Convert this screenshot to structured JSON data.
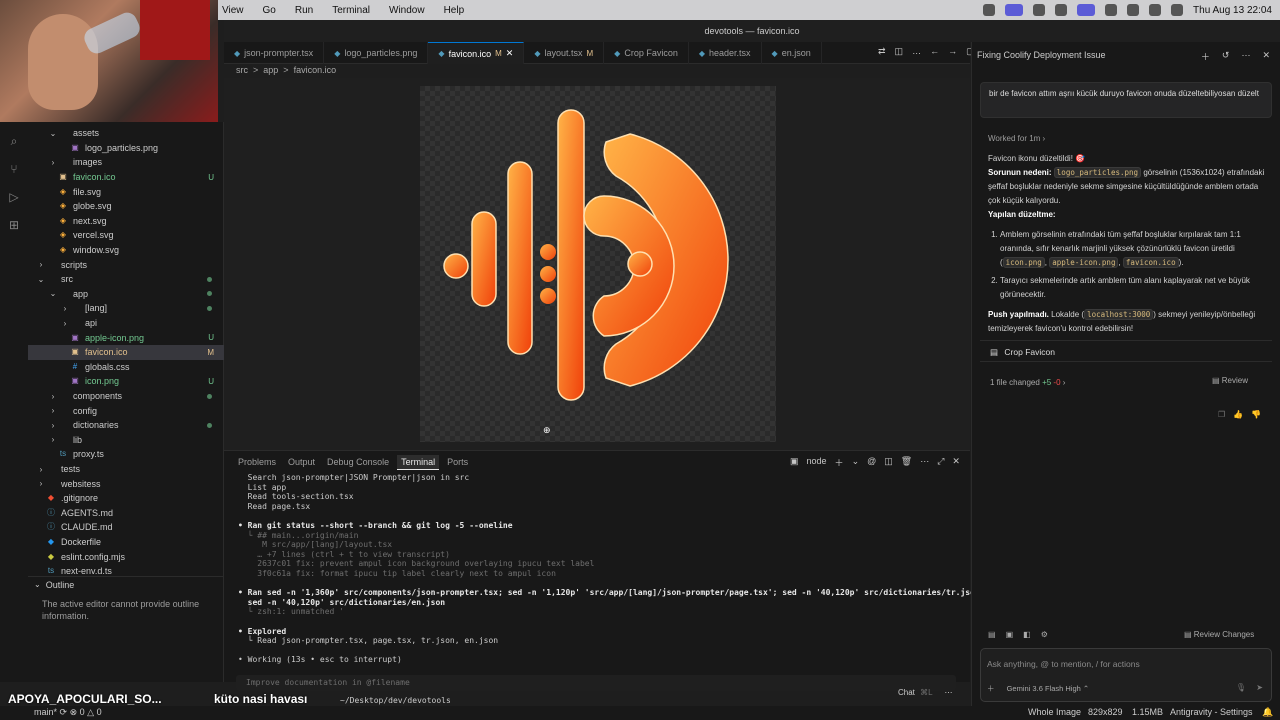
{
  "menubar": {
    "menus": [
      "View",
      "Go",
      "Run",
      "Terminal",
      "Window",
      "Help"
    ],
    "clock": "Thu Aug 13  22:04"
  },
  "window_title": "devotools — favicon.ico",
  "tabs": [
    {
      "label": "json-prompter.tsx",
      "badge": "",
      "active": false
    },
    {
      "label": "logo_particles.png",
      "badge": "",
      "active": false
    },
    {
      "label": "favicon.ico",
      "badge": "M",
      "active": true
    },
    {
      "label": "layout.tsx",
      "badge": "M",
      "active": false
    },
    {
      "label": "Crop Favicon",
      "badge": "",
      "active": false
    },
    {
      "label": "header.tsx",
      "badge": "",
      "active": false
    },
    {
      "label": "en.json",
      "badge": "",
      "active": false
    }
  ],
  "breadcrumb": [
    "src",
    ">",
    "app",
    ">",
    "favicon.ico"
  ],
  "explorer": {
    "rows": [
      {
        "label": "assets",
        "type": "folder",
        "depth": 1,
        "open": true,
        "status": ""
      },
      {
        "label": "logo_particles.png",
        "type": "png",
        "depth": 2,
        "open": false,
        "status": ""
      },
      {
        "label": "images",
        "type": "folder",
        "depth": 1,
        "open": false,
        "status": ""
      },
      {
        "label": "favicon.ico",
        "type": "ico",
        "depth": 1,
        "open": false,
        "status": "U"
      },
      {
        "label": "file.svg",
        "type": "svg",
        "depth": 1,
        "open": false,
        "status": ""
      },
      {
        "label": "globe.svg",
        "type": "svg",
        "depth": 1,
        "open": false,
        "status": ""
      },
      {
        "label": "next.svg",
        "type": "svg",
        "depth": 1,
        "open": false,
        "status": ""
      },
      {
        "label": "vercel.svg",
        "type": "svg",
        "depth": 1,
        "open": false,
        "status": ""
      },
      {
        "label": "window.svg",
        "type": "svg",
        "depth": 1,
        "open": false,
        "status": ""
      },
      {
        "label": "scripts",
        "type": "folder",
        "depth": 0,
        "open": false,
        "status": ""
      },
      {
        "label": "src",
        "type": "folder",
        "depth": 0,
        "open": true,
        "status": "dot"
      },
      {
        "label": "app",
        "type": "folder",
        "depth": 1,
        "open": true,
        "status": "dot"
      },
      {
        "label": "[lang]",
        "type": "folder",
        "depth": 2,
        "open": false,
        "status": "dot"
      },
      {
        "label": "api",
        "type": "folder",
        "depth": 2,
        "open": false,
        "status": ""
      },
      {
        "label": "apple-icon.png",
        "type": "png",
        "depth": 2,
        "open": false,
        "status": "U"
      },
      {
        "label": "favicon.ico",
        "type": "ico",
        "depth": 2,
        "open": false,
        "status": "M",
        "selected": true
      },
      {
        "label": "globals.css",
        "type": "css",
        "depth": 2,
        "open": false,
        "status": ""
      },
      {
        "label": "icon.png",
        "type": "png",
        "depth": 2,
        "open": false,
        "status": "U"
      },
      {
        "label": "components",
        "type": "folder",
        "depth": 1,
        "open": false,
        "status": "dot"
      },
      {
        "label": "config",
        "type": "folder",
        "depth": 1,
        "open": false,
        "status": ""
      },
      {
        "label": "dictionaries",
        "type": "folder",
        "depth": 1,
        "open": false,
        "status": "dot"
      },
      {
        "label": "lib",
        "type": "folder",
        "depth": 1,
        "open": false,
        "status": ""
      },
      {
        "label": "proxy.ts",
        "type": "ts",
        "depth": 1,
        "open": false,
        "status": ""
      },
      {
        "label": "tests",
        "type": "folder",
        "depth": 0,
        "open": false,
        "status": ""
      },
      {
        "label": "websitess",
        "type": "folder",
        "depth": 0,
        "open": false,
        "status": ""
      },
      {
        "label": ".gitignore",
        "type": "git",
        "depth": 0,
        "open": false,
        "status": ""
      },
      {
        "label": "AGENTS.md",
        "type": "md",
        "depth": 0,
        "open": false,
        "status": ""
      },
      {
        "label": "CLAUDE.md",
        "type": "md",
        "depth": 0,
        "open": false,
        "status": ""
      },
      {
        "label": "Dockerfile",
        "type": "docker",
        "depth": 0,
        "open": false,
        "status": ""
      },
      {
        "label": "eslint.config.mjs",
        "type": "js",
        "depth": 0,
        "open": false,
        "status": ""
      },
      {
        "label": "next-env.d.ts",
        "type": "ts",
        "depth": 0,
        "open": false,
        "status": ""
      }
    ],
    "outline_title": "Outline",
    "outline_message": "The active editor cannot provide outline information."
  },
  "panel": {
    "tabs": [
      "Problems",
      "Output",
      "Debug Console",
      "Terminal",
      "Ports"
    ],
    "active_tab": "Terminal",
    "terminal_name": "node",
    "input_placeholder": "Improve documentation in @filename",
    "chat_label": "Chat",
    "lines": [
      {
        "cls": "",
        "text": "  Search json-prompter|JSON Prompter|json in src"
      },
      {
        "cls": "",
        "text": "  List app"
      },
      {
        "cls": "",
        "text": "  Read tools-section.tsx"
      },
      {
        "cls": "",
        "text": "  Read page.tsx"
      },
      {
        "cls": "",
        "text": ""
      },
      {
        "cls": "b",
        "text": "• Ran git status --short --branch && git log -5 --oneline"
      },
      {
        "cls": "dim",
        "text": "  └ ## main...origin/main"
      },
      {
        "cls": "dim",
        "text": "     M src/app/[lang]/layout.tsx"
      },
      {
        "cls": "dim",
        "text": "    … +7 lines (ctrl + t to view transcript)"
      },
      {
        "cls": "dim",
        "text": "    2637c01 fix: prevent ampul icon background overlaying ipucu text label"
      },
      {
        "cls": "dim",
        "text": "    3f0c61a fix: format ipucu tip label clearly next to ampul icon"
      },
      {
        "cls": "",
        "text": ""
      },
      {
        "cls": "b",
        "text": "• Ran sed -n '1,360p' src/components/json-prompter.tsx; sed -n '1,120p' 'src/app/[lang]/json-prompter/page.tsx'; sed -n '40,120p' src/dictionaries/tr.json;"
      },
      {
        "cls": "b",
        "text": "  sed -n '40,120p' src/dictionaries/en.json"
      },
      {
        "cls": "dim",
        "text": "  └ zsh:1: unmatched '"
      },
      {
        "cls": "",
        "text": ""
      },
      {
        "cls": "b",
        "text": "• Explored"
      },
      {
        "cls": "",
        "text": "  └ Read json-prompter.tsx, page.tsx, tr.json, en.json"
      },
      {
        "cls": "",
        "text": ""
      },
      {
        "cls": "",
        "text": "• Working (13s • esc to interrupt)"
      }
    ]
  },
  "status": {
    "overlay_name": "APOYA_APOCULARI_SO...",
    "overlay_song": "küto nasi havası",
    "path": "~/Desktop/dev/devotools",
    "branch": "main*",
    "errors": "0",
    "warnings": "0",
    "whole_image": "Whole Image",
    "dimensions": "829x829",
    "size": "1.15MB",
    "settings": "Antigravity - Settings"
  },
  "chat": {
    "title": "Fixing Coolify Deployment Issue",
    "user_message": "bir de favicon attım aşrıı kücük duruyo favicon onuda düzeltebiliyosan düzelt",
    "worked_for": "Worked for 1m",
    "intro": "Favicon ikonu düzeltildi! 🎯",
    "cause_label": "Sorunun nedeni:",
    "cause_code": "logo_particles.png",
    "cause_text": "görselinin (1536x1024) etrafındaki şeffaf boşluklar nedeniyle sekme simgesine küçültüldüğünde amblem ortada çok küçük kalıyordu.",
    "fix_label": "Yapılan düzeltme:",
    "fix1_text": "Amblem görselinin etrafındaki tüm şeffaf boşluklar kırpılarak tam 1:1 oranında, sıfır kenarlık marjinli yüksek çözünürlüklü favicon üretildi (",
    "fix1_code1": "icon.png",
    "fix1_code2": "apple-icon.png",
    "fix1_code3": "favicon.ico",
    "fix1_end": ").",
    "fix2_text": "Tarayıcı sekmelerinde artık amblem tüm alanı kaplayarak net ve büyük görünecektir.",
    "push_label": "Push yapılmadı.",
    "push_text1": "Lokalde (",
    "push_code": "localhost:3000",
    "push_text2": ") sekmeyi yenileyip/önbelleği temizleyerek favicon'u kontrol edebilirsin!",
    "card_label": "Crop Favicon",
    "files_changed": "1 file changed",
    "additions": "+5",
    "deletions": "-0",
    "review": "Review",
    "review_changes": "Review Changes",
    "input_placeholder": "Ask anything, @ to mention, / for actions",
    "model": "Gemini 3.6 Flash High"
  },
  "colors": {
    "accent": "#0078d4",
    "modified": "#e2c08d",
    "untracked": "#73c991",
    "logo_orange": "#ff7a1a"
  }
}
